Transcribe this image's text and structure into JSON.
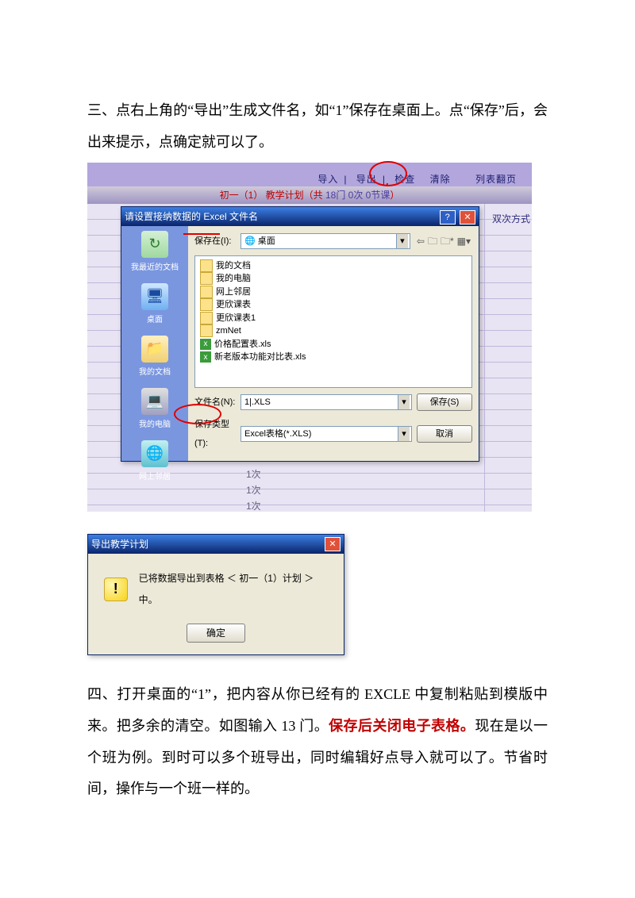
{
  "para1": "三、点右上角的“导出”生成文件名，如“1”保存在桌面上。点“保存”后，会出来提示，点确定就可以了。",
  "para2_a": "四、打开桌面的“1”，把内容从你已经有的 EXCLE 中复制粘贴到模版中来。把多余的清空。如图输入 13 门。",
  "para2_red": "保存后关闭电子表格。",
  "para2_b": "现在是以一个班为例。到时可以多个班导出，同时编辑好点导入就可以了。节省时间，操作与一个班一样的。",
  "shot1": {
    "toolbar": {
      "import": "导入",
      "export": "导出",
      "check": "检查",
      "clear": "清除",
      "flip": "列表翻页"
    },
    "subtitle_a": "初一（1） 教学计划（共 ",
    "subtitle_b": "18门 0次 0节课",
    "subtitle_c": "）",
    "right_label": "双次方式",
    "ci": "1次",
    "dialog": {
      "title": "请设置接纳数据的 Excel 文件名",
      "save_in_label": "保存在(I):",
      "save_in_value": "🌐 桌面",
      "sidebar": {
        "recent": "我最近的文档",
        "desktop": "桌面",
        "docs": "我的文档",
        "comp": "我的电脑",
        "net": "网上邻居"
      },
      "files": {
        "f1": "我的文档",
        "f2": "我的电脑",
        "f3": "网上邻居",
        "f4": "更欣课表",
        "f5": "更欣课表1",
        "f6": "zmNet",
        "f7": "价格配置表.xls",
        "f8": "新老版本功能对比表.xls"
      },
      "filename_label": "文件名(N):",
      "filename_value": "1|.XLS",
      "filetype_label": "保存类型(T):",
      "filetype_value": "Excel表格(*.XLS)",
      "save_btn": "保存(S)",
      "cancel_btn": "取消"
    }
  },
  "shot2": {
    "title": "导出教学计划",
    "msg": "已将数据导出到表格 ＜ 初一（1）计划 ＞ 中。",
    "ok": "确定"
  }
}
